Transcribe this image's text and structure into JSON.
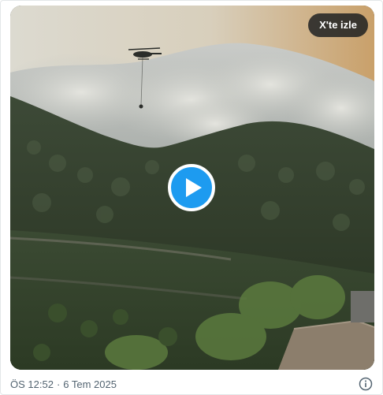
{
  "media": {
    "watch_on_x_label": "X'te izle",
    "scene_description_icon": "video-thumbnail-forest-fire"
  },
  "meta": {
    "time": "ÖS 12:52",
    "separator": "·",
    "date": "6 Tem 2025"
  },
  "icons": {
    "play": "play-icon",
    "info": "info-icon"
  },
  "colors": {
    "play_button": "#1d9bf0",
    "meta_text": "#536471",
    "watch_button_bg": "#0f1419"
  }
}
